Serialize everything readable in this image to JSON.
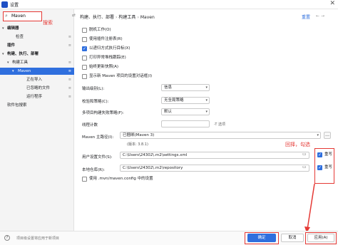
{
  "window": {
    "title": "设置",
    "close_glyph": "✕"
  },
  "search": {
    "value": "Maven",
    "icon": "search-icon",
    "annotation": "搜索"
  },
  "sidebar": {
    "items": [
      {
        "label": "编辑器",
        "level": 0,
        "expanded": true
      },
      {
        "label": "检查",
        "level": 1
      },
      {
        "label": "插件",
        "level": 0
      },
      {
        "label": "构建、执行、部署",
        "level": 0,
        "expanded": true
      },
      {
        "label": "构建工具",
        "level": 1,
        "expanded": true
      },
      {
        "label": "Maven",
        "level": 2,
        "expanded": true,
        "selected": true
      },
      {
        "label": "正在导入",
        "level": 3
      },
      {
        "label": "已忽略的文件",
        "level": 3
      },
      {
        "label": "运行程序",
        "level": 3
      },
      {
        "label": "软件包搜索",
        "level": 0
      }
    ]
  },
  "breadcrumb": {
    "items": [
      "构建、执行、部署",
      "构建工具",
      "Maven"
    ],
    "separator": "›"
  },
  "header": {
    "reset_label": "重置",
    "back_glyph": "←",
    "forward_glyph": "→"
  },
  "options": [
    {
      "label": "脱机工作(O)",
      "checked": false
    },
    {
      "label": "使用插件注册表(R)",
      "checked": false
    },
    {
      "label": "以递归方式执行目标(X)",
      "checked": true
    },
    {
      "label": "打印异常堆栈跟踪(E)",
      "checked": false
    },
    {
      "label": "始终更新快照(A)",
      "checked": false
    },
    {
      "label": "显示新 Maven 项目的设置对话框(I)",
      "checked": false
    }
  ],
  "output_level": {
    "label": "输出级别(L):",
    "value": "信息"
  },
  "checksum_policy": {
    "label": "校验和策略(C):",
    "value": "无全局策略"
  },
  "multiproject_fail": {
    "label": "多项目构建失败策略(F):",
    "value": "默认"
  },
  "threads": {
    "label": "线程计数",
    "value": "",
    "suffix": "-T 选项"
  },
  "maven_home": {
    "label": "Maven 主路径(I):",
    "value": "已捆绑(Maven 3)",
    "version": "(版本: 3.8.1)"
  },
  "user_settings": {
    "label": "用户设置文件(S):",
    "value": "C:\\Users\\24302\\.m2\\settings.xml",
    "override_label": "重写",
    "override": true
  },
  "local_repo": {
    "label": "本地仓库(R):",
    "value": "C:\\Users\\24302\\.m2\\repository",
    "override_label": "重写",
    "override": true
  },
  "use_mvn_config": {
    "label": "使用 .mvn/maven.config 中的设置",
    "checked": false
  },
  "annotations": {
    "check_note": "回择，勾选"
  },
  "footer": {
    "help_glyph": "?",
    "note": "项目级设置将应用于新项目",
    "ok_label": "确定",
    "cancel_label": "取消",
    "apply_label": "应用(A)"
  },
  "colors": {
    "accent": "#2f6fde",
    "annotation": "#e53935"
  }
}
